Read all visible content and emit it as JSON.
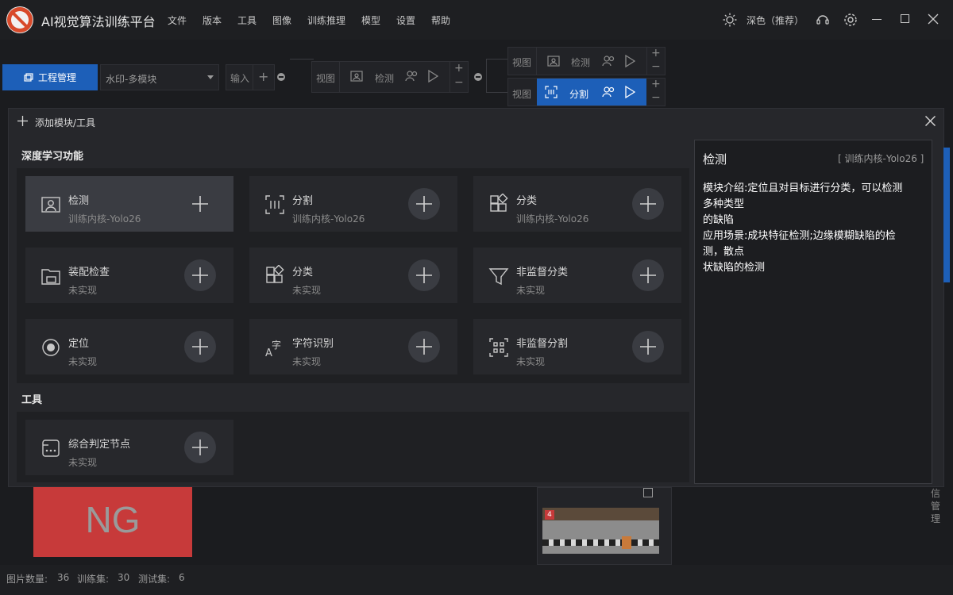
{
  "app": {
    "title": "AI视觉算法训练平台",
    "menu": [
      "文件",
      "版本",
      "工具",
      "图像",
      "训练推理",
      "模型",
      "设置",
      "帮助"
    ],
    "theme_label": "深色（推荐）"
  },
  "toolbar": {
    "project_button": "工程管理",
    "project_select": "水印-多模块",
    "input_label": "输入",
    "view_label": "视图",
    "detect_label": "检测",
    "segment_label": "分割",
    "plus": "+",
    "minus": "−"
  },
  "dialog": {
    "title": "添加模块/工具",
    "sections": [
      {
        "title": "深度学习功能",
        "cards": [
          {
            "title": "检测",
            "sub": "训练内核-Yolo26",
            "icon": "detect-icon"
          },
          {
            "title": "分割",
            "sub": "训练内核-Yolo26",
            "icon": "segment-icon"
          },
          {
            "title": "分类",
            "sub": "训练内核-Yolo26",
            "icon": "classify-icon"
          },
          {
            "title": "装配检查",
            "sub": "未实现",
            "icon": "assembly-icon"
          },
          {
            "title": "分类",
            "sub": "未实现",
            "icon": "classify-icon"
          },
          {
            "title": "非监督分类",
            "sub": "未实现",
            "icon": "filter-icon"
          },
          {
            "title": "定位",
            "sub": "未实现",
            "icon": "locate-icon"
          },
          {
            "title": "字符识别",
            "sub": "未实现",
            "icon": "ocr-icon"
          },
          {
            "title": "非监督分割",
            "sub": "未实现",
            "icon": "unsupervised-segment-icon"
          }
        ]
      },
      {
        "title": "工具",
        "cards": [
          {
            "title": "综合判定节点",
            "sub": "未实现",
            "icon": "judge-node-icon"
          }
        ]
      }
    ],
    "detail": {
      "title": "检测",
      "tag": "[ 训练内核-Yolo26 ]",
      "lines": [
        "模块介绍:定位且对目标进行分类，可以检测",
        "多种类型",
        "的缺陷",
        "应用场景:成块特征检测;边缘模糊缺陷的检",
        "测，散点",
        "状缺陷的检测"
      ]
    }
  },
  "background": {
    "ng_label": "NG",
    "thumb_badge": "4",
    "side_text": "信管理"
  },
  "footer": {
    "image_count_label": "图片数量:",
    "image_count": "36",
    "train_label": "训练集:",
    "train_count": "30",
    "test_label": "测试集:",
    "test_count": "6"
  },
  "colors": {
    "accent": "#1d5fb8",
    "ng": "#c73a3a",
    "bg": "#1b1c1f"
  }
}
